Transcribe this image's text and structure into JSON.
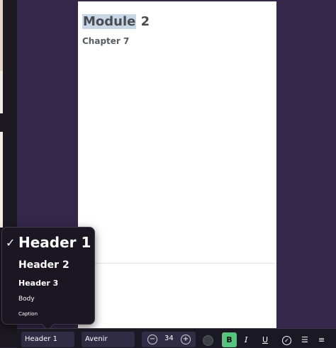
{
  "document": {
    "title_highlighted": "Module",
    "title_rest": " 2",
    "subtitle": "Chapter 7"
  },
  "style_menu": {
    "items": [
      {
        "label": "Header 1",
        "selected": true
      },
      {
        "label": "Header 2",
        "selected": false
      },
      {
        "label": "Header 3",
        "selected": false
      },
      {
        "label": "Body",
        "selected": false
      },
      {
        "label": "Caption",
        "selected": false
      }
    ],
    "check": "✓"
  },
  "toolbar": {
    "style_value": "Header 1",
    "font_value": "Avenir",
    "size_value": "34",
    "size_decrease": "−",
    "size_increase": "+",
    "text_color": "#3d3f45",
    "bold_label": "B",
    "bold_active_color": "#56c47c",
    "italic_label": "I",
    "underline_label": "U",
    "check_icon": "check-circle-icon",
    "bullet_icon": "bullet-list-icon",
    "number_icon": "numbered-list-icon"
  }
}
